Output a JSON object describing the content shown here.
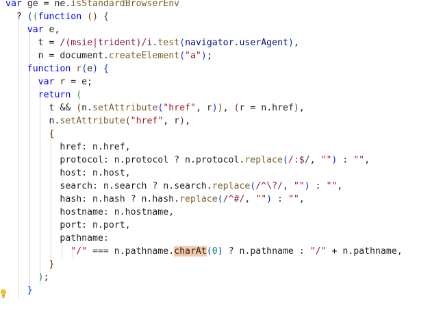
{
  "editor": {
    "lines": [
      [
        [
          "kw",
          "var"
        ],
        [
          "p",
          " ge = ne."
        ],
        [
          "fn",
          "isStandardBrowserEnv"
        ]
      ],
      [
        [
          "p",
          "  ? "
        ],
        [
          "br1",
          "("
        ],
        [
          "br2",
          "("
        ],
        [
          "kw",
          "function"
        ],
        [
          "p",
          " "
        ],
        [
          "br3",
          "()"
        ],
        [
          "p",
          " "
        ],
        [
          "br3",
          "{"
        ]
      ],
      [
        [
          "p",
          "    "
        ],
        [
          "kw",
          "var"
        ],
        [
          "p",
          " e,"
        ]
      ],
      [
        [
          "p",
          "      t = "
        ],
        [
          "re",
          "/(msie|trident)/i"
        ],
        [
          "p",
          "."
        ],
        [
          "fn",
          "test"
        ],
        [
          "br1",
          "("
        ],
        [
          "prop",
          "navigator"
        ],
        [
          "p",
          "."
        ],
        [
          "prop",
          "userAgent"
        ],
        [
          "br1",
          ")"
        ],
        [
          "p",
          ","
        ]
      ],
      [
        [
          "p",
          "      n = document."
        ],
        [
          "fn",
          "createElement"
        ],
        [
          "br1",
          "("
        ],
        [
          "str",
          "\"a\""
        ],
        [
          "br1",
          ")"
        ],
        [
          "p",
          ";"
        ]
      ],
      [
        [
          "p",
          "    "
        ],
        [
          "kw",
          "function"
        ],
        [
          "p",
          " "
        ],
        [
          "fn",
          "r"
        ],
        [
          "br1",
          "("
        ],
        [
          "p",
          "e"
        ],
        [
          "br1",
          ")"
        ],
        [
          "p",
          " "
        ],
        [
          "br1",
          "{"
        ]
      ],
      [
        [
          "p",
          "      "
        ],
        [
          "kw",
          "var"
        ],
        [
          "p",
          " r = e;"
        ]
      ],
      [
        [
          "p",
          "      "
        ],
        [
          "kw",
          "return"
        ],
        [
          "p",
          " "
        ],
        [
          "br2",
          "("
        ]
      ],
      [
        [
          "p",
          "        t && "
        ],
        [
          "br3",
          "("
        ],
        [
          "p",
          "n."
        ],
        [
          "fn",
          "setAttribute"
        ],
        [
          "br1",
          "("
        ],
        [
          "str",
          "\"href\""
        ],
        [
          "p",
          ", r"
        ],
        [
          "br1",
          ")"
        ],
        [
          "br3",
          ")"
        ],
        [
          "p",
          ", "
        ],
        [
          "br3",
          "("
        ],
        [
          "p",
          "r = n.href"
        ],
        [
          "br3",
          ")"
        ],
        [
          "p",
          ","
        ]
      ],
      [
        [
          "p",
          "        n."
        ],
        [
          "fn",
          "setAttribute"
        ],
        [
          "br3",
          "("
        ],
        [
          "str",
          "\"href\""
        ],
        [
          "p",
          ", r"
        ],
        [
          "br3",
          ")"
        ],
        [
          "p",
          ","
        ]
      ],
      [
        [
          "p",
          "        "
        ],
        [
          "br3",
          "{"
        ]
      ],
      [
        [
          "p",
          "          href: n.href,"
        ]
      ],
      [
        [
          "p",
          "          protocol: n.protocol ? n.protocol."
        ],
        [
          "fn",
          "replace"
        ],
        [
          "br1",
          "("
        ],
        [
          "re",
          "/:$/"
        ],
        [
          "p",
          ", "
        ],
        [
          "str",
          "\"\""
        ],
        [
          "br1",
          ")"
        ],
        [
          "p",
          " : "
        ],
        [
          "str",
          "\"\""
        ],
        [
          "p",
          ","
        ]
      ],
      [
        [
          "p",
          "          host: n.host,"
        ]
      ],
      [
        [
          "p",
          "          search: n.search ? n.search."
        ],
        [
          "fn",
          "replace"
        ],
        [
          "br1",
          "("
        ],
        [
          "re",
          "/^\\?/"
        ],
        [
          "p",
          ", "
        ],
        [
          "str",
          "\"\""
        ],
        [
          "br1",
          ")"
        ],
        [
          "p",
          " : "
        ],
        [
          "str",
          "\"\""
        ],
        [
          "p",
          ","
        ]
      ],
      [
        [
          "p",
          "          hash: n.hash ? n.hash."
        ],
        [
          "fn",
          "replace"
        ],
        [
          "br1",
          "("
        ],
        [
          "re",
          "/^#/"
        ],
        [
          "p",
          ", "
        ],
        [
          "str",
          "\"\""
        ],
        [
          "br1",
          ")"
        ],
        [
          "p",
          " : "
        ],
        [
          "str",
          "\"\""
        ],
        [
          "p",
          ","
        ]
      ],
      [
        [
          "p",
          "          hostname: n.hostname,"
        ]
      ],
      [
        [
          "p",
          "          port: n.port,"
        ]
      ],
      [
        [
          "p",
          "          pathname:"
        ]
      ],
      [
        [
          "p",
          "            "
        ],
        [
          "str",
          "\"/\""
        ],
        [
          "p",
          " === n.pathname."
        ],
        [
          "hl",
          "charAt"
        ],
        [
          "br1",
          "("
        ],
        [
          "num",
          "0"
        ],
        [
          "br1",
          ")"
        ],
        [
          "p",
          " ? n.pathname : "
        ],
        [
          "str",
          "\"/\""
        ],
        [
          "p",
          " + n.pathname,"
        ]
      ],
      [
        [
          "p",
          "        "
        ],
        [
          "br3",
          "}"
        ]
      ],
      [
        [
          "p",
          "      "
        ],
        [
          "br2",
          ")"
        ],
        [
          "p",
          ";"
        ]
      ],
      [
        [
          "p",
          "    "
        ],
        [
          "br1",
          "}"
        ]
      ],
      [
        [
          "p",
          "  "
        ]
      ]
    ],
    "lightbulb_icon": "lightbulb-icon"
  }
}
